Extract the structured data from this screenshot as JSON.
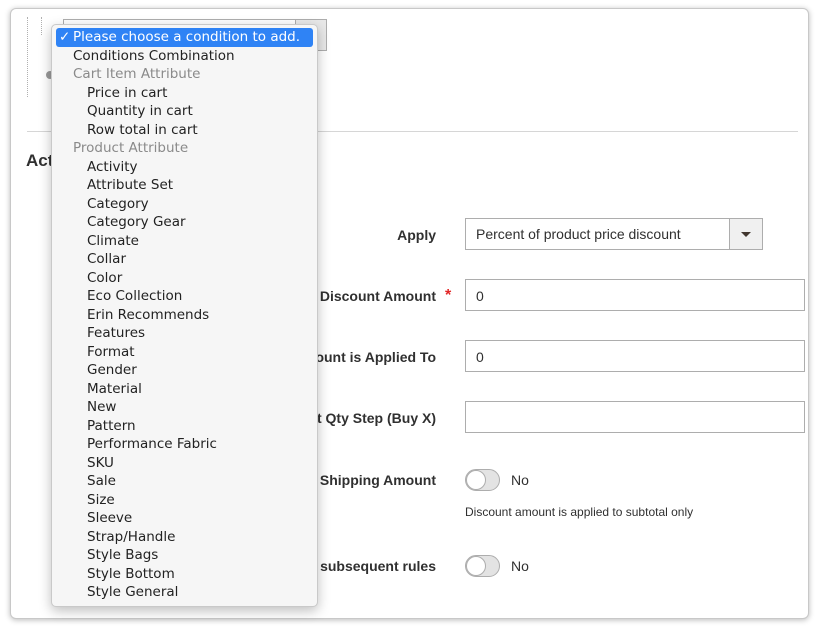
{
  "condition_select": {
    "selected": "Please choose a condition to add.",
    "options": [
      {
        "label": "Conditions Combination",
        "kind": "top"
      },
      {
        "label": "Cart Item Attribute",
        "kind": "group"
      },
      {
        "label": "Price in cart",
        "kind": "sub"
      },
      {
        "label": "Quantity in cart",
        "kind": "sub"
      },
      {
        "label": "Row total in cart",
        "kind": "sub"
      },
      {
        "label": "Product Attribute",
        "kind": "group"
      },
      {
        "label": "Activity",
        "kind": "sub"
      },
      {
        "label": "Attribute Set",
        "kind": "sub"
      },
      {
        "label": "Category",
        "kind": "sub"
      },
      {
        "label": "Category Gear",
        "kind": "sub"
      },
      {
        "label": "Climate",
        "kind": "sub"
      },
      {
        "label": "Collar",
        "kind": "sub"
      },
      {
        "label": "Color",
        "kind": "sub"
      },
      {
        "label": "Eco Collection",
        "kind": "sub"
      },
      {
        "label": "Erin Recommends",
        "kind": "sub"
      },
      {
        "label": "Features",
        "kind": "sub"
      },
      {
        "label": "Format",
        "kind": "sub"
      },
      {
        "label": "Gender",
        "kind": "sub"
      },
      {
        "label": "Material",
        "kind": "sub"
      },
      {
        "label": "New",
        "kind": "sub"
      },
      {
        "label": "Pattern",
        "kind": "sub"
      },
      {
        "label": "Performance Fabric",
        "kind": "sub"
      },
      {
        "label": "SKU",
        "kind": "sub"
      },
      {
        "label": "Sale",
        "kind": "sub"
      },
      {
        "label": "Size",
        "kind": "sub"
      },
      {
        "label": "Sleeve",
        "kind": "sub"
      },
      {
        "label": "Strap/Handle",
        "kind": "sub"
      },
      {
        "label": "Style Bags",
        "kind": "sub"
      },
      {
        "label": "Style Bottom",
        "kind": "sub"
      },
      {
        "label": "Style General",
        "kind": "sub"
      }
    ]
  },
  "section": {
    "title_visible": "Act"
  },
  "form": {
    "apply": {
      "label": "Apply",
      "value": "Percent of product price discount"
    },
    "discount_amount": {
      "label": "Discount Amount",
      "required_mark": "*",
      "value": "0"
    },
    "max_qty": {
      "label": "count is Applied To",
      "value": "0"
    },
    "qty_step": {
      "label": "nt Qty Step (Buy X)",
      "value": ""
    },
    "apply_shipping": {
      "label": "o Shipping Amount",
      "toggle_text": "No",
      "note": "Discount amount is applied to subtotal only"
    },
    "discard_rules": {
      "label": "l subsequent rules",
      "toggle_text": "No"
    }
  }
}
